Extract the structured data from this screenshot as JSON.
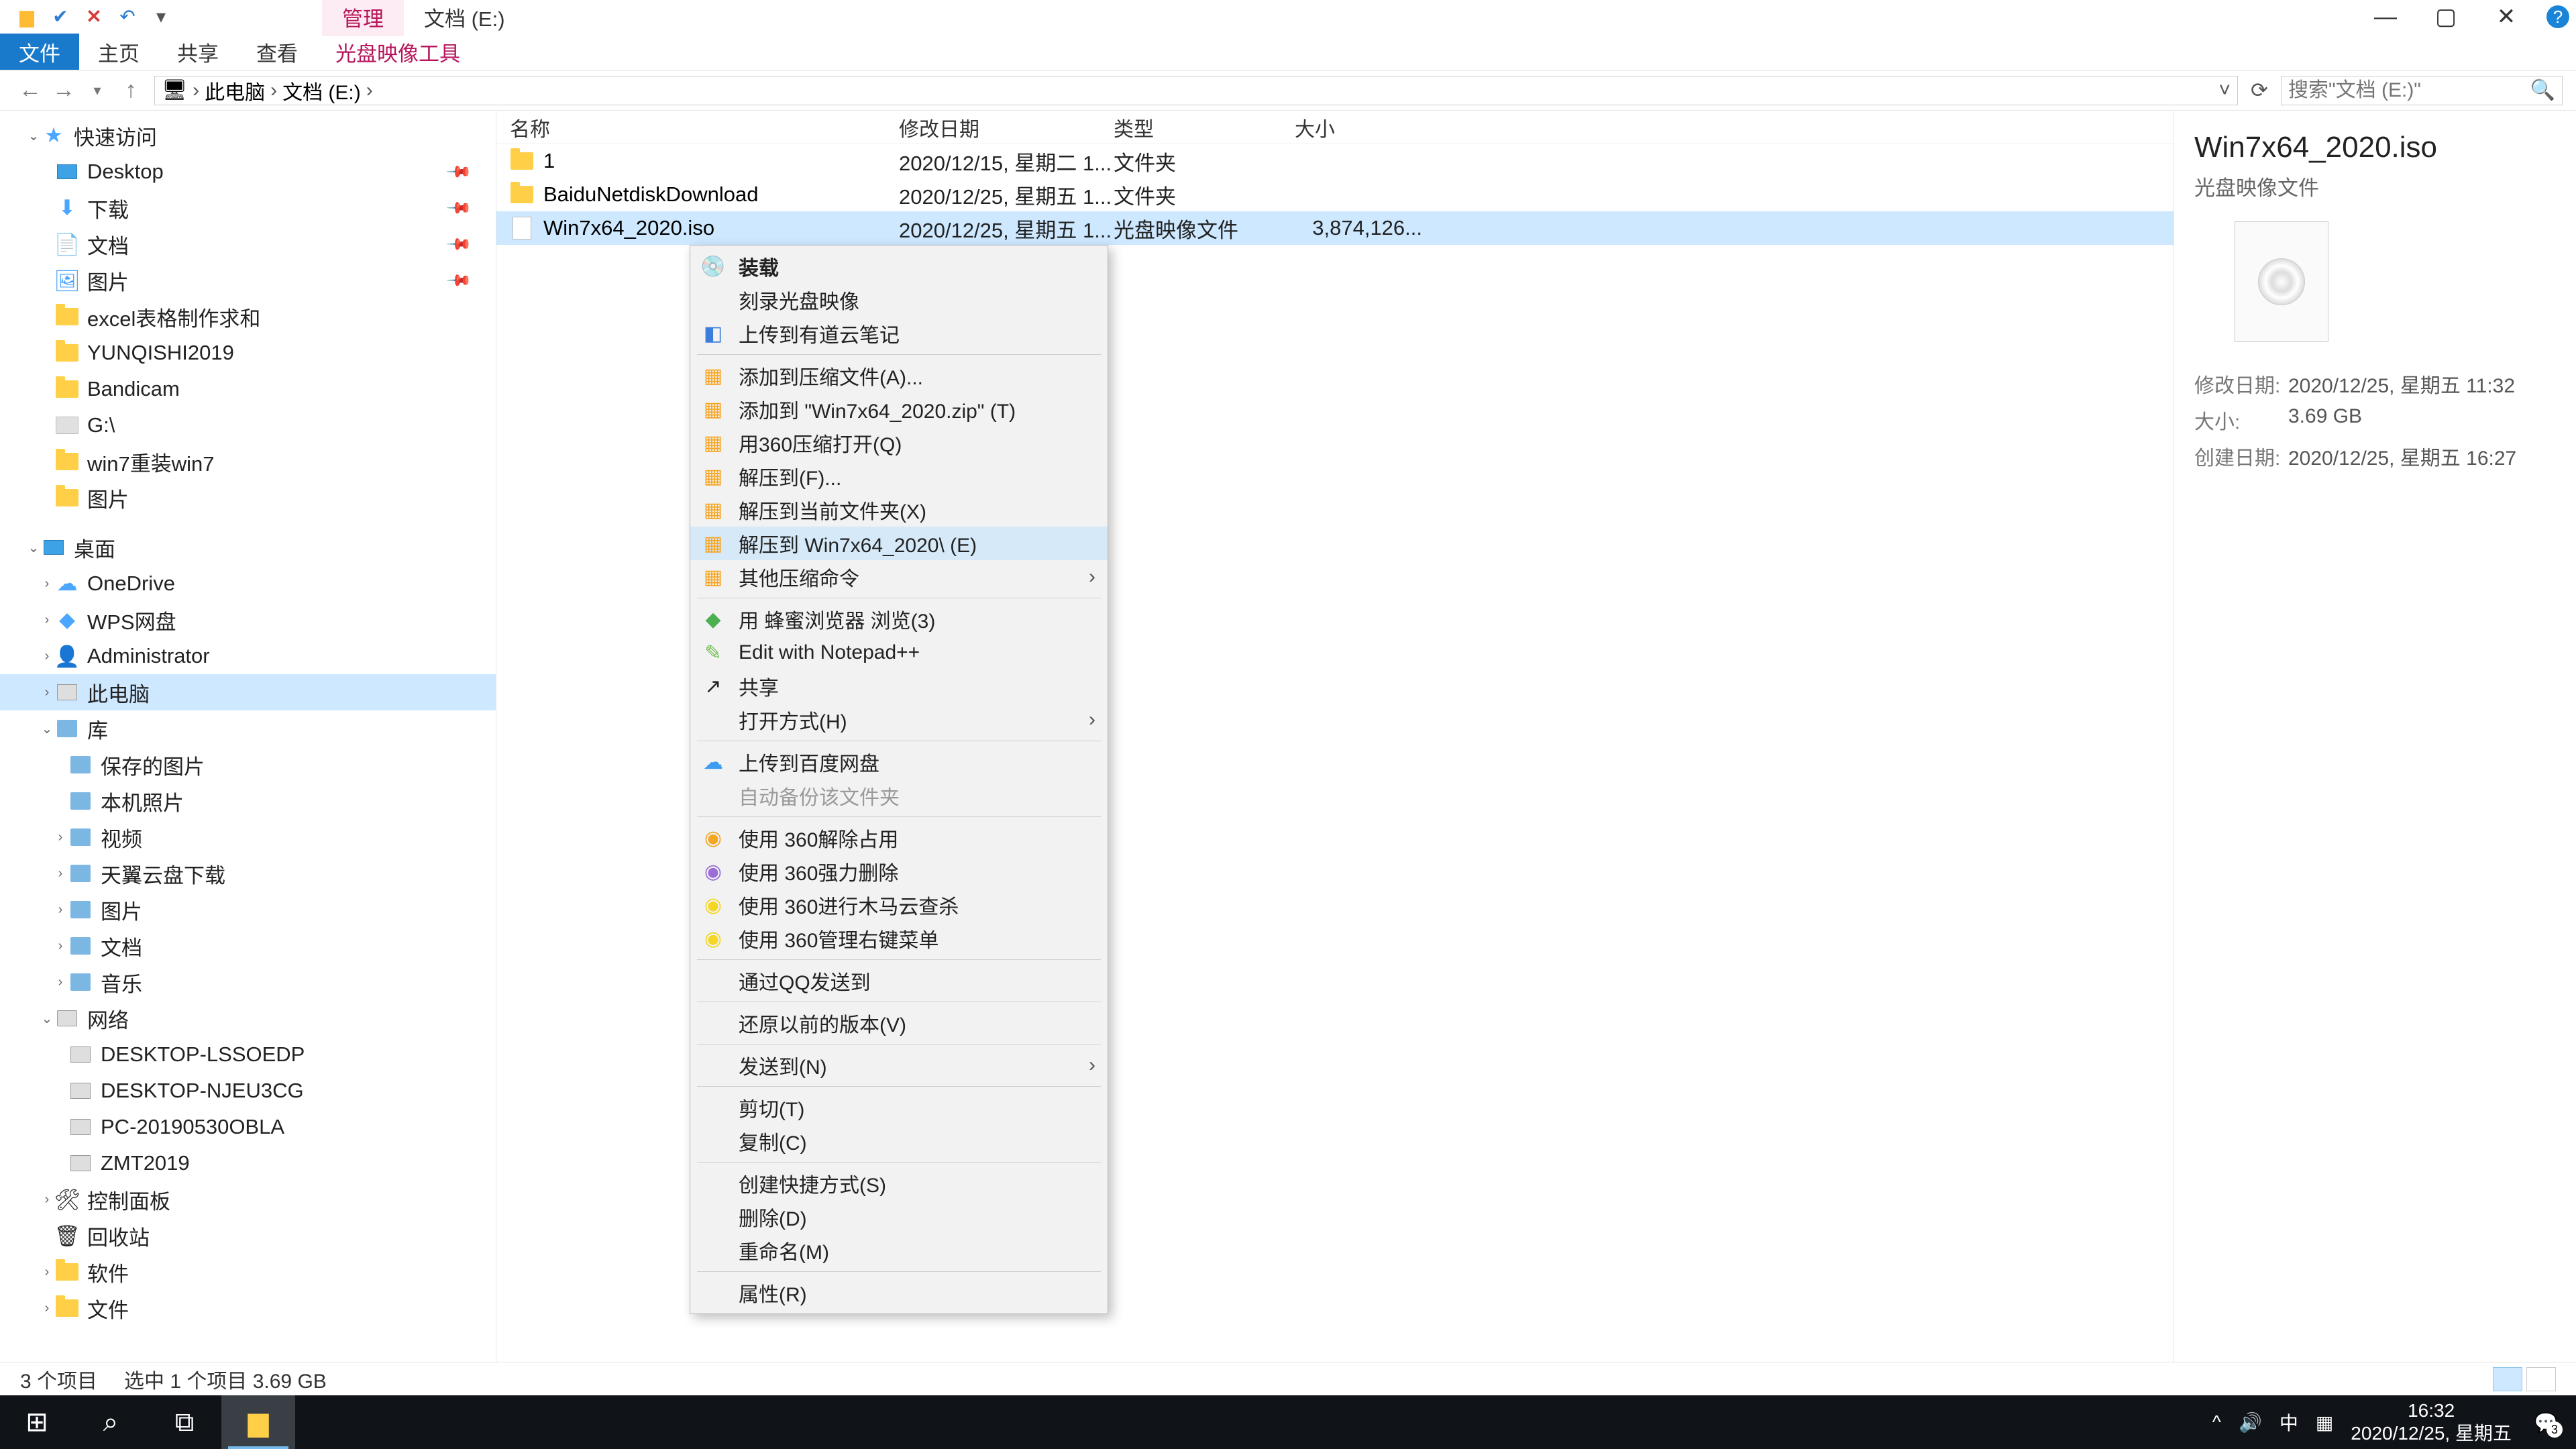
{
  "titlebar": {
    "tab_admin": "管理",
    "tab_title": "文档 (E:)"
  },
  "ribbon": {
    "file": "文件",
    "home": "主页",
    "share": "共享",
    "view": "查看",
    "iso_tool": "光盘映像工具"
  },
  "breadcrumb": {
    "pc": "此电脑",
    "drive": "文档 (E:)"
  },
  "search": {
    "placeholder": "搜索\"文档 (E:)\""
  },
  "sidebar": {
    "quick_access": "快速访问",
    "desktop": "Desktop",
    "downloads": "下载",
    "documents": "文档",
    "pictures": "图片",
    "excel": "excel表格制作求和",
    "yunqishi": "YUNQISHI2019",
    "bandicam": "Bandicam",
    "gdrive": "G:\\",
    "win7setup": "win7重装win7",
    "pictures2": "图片",
    "desktop_group": "桌面",
    "onedrive": "OneDrive",
    "wps": "WPS网盘",
    "admin": "Administrator",
    "this_pc": "此电脑",
    "library": "库",
    "saved_pic": "保存的图片",
    "local_pic": "本机照片",
    "video": "视频",
    "tianyi": "天翼云盘下载",
    "pictures3": "图片",
    "documents2": "文档",
    "music": "音乐",
    "network": "网络",
    "net1": "DESKTOP-LSSOEDP",
    "net2": "DESKTOP-NJEU3CG",
    "net3": "PC-20190530OBLA",
    "net4": "ZMT2019",
    "ctrl_panel": "控制面板",
    "recycle": "回收站",
    "software": "软件",
    "files": "文件"
  },
  "columns": {
    "name": "名称",
    "date": "修改日期",
    "type": "类型",
    "size": "大小"
  },
  "rows": [
    {
      "name": "1",
      "date": "2020/12/15, 星期二 1...",
      "type": "文件夹",
      "size": ""
    },
    {
      "name": "BaiduNetdiskDownload",
      "date": "2020/12/25, 星期五 1...",
      "type": "文件夹",
      "size": ""
    },
    {
      "name": "Win7x64_2020.iso",
      "date": "2020/12/25, 星期五 1...",
      "type": "光盘映像文件",
      "size": "3,874,126..."
    }
  ],
  "ctx": {
    "mount": "装载",
    "burn": "刻录光盘映像",
    "youdao": "上传到有道云笔记",
    "addzip": "添加到压缩文件(A)...",
    "addzip2": "添加到 \"Win7x64_2020.zip\" (T)",
    "open360zip": "用360压缩打开(Q)",
    "extract_to": "解压到(F)...",
    "extract_here": "解压到当前文件夹(X)",
    "extract_named": "解压到 Win7x64_2020\\ (E)",
    "other_zip": "其他压缩命令",
    "browser": "用 蜂蜜浏览器 浏览(3)",
    "npp": "Edit with Notepad++",
    "share": "共享",
    "open_with": "打开方式(H)",
    "upload_baidu": "上传到百度网盘",
    "auto_backup": "自动备份该文件夹",
    "unlock360": "使用 360解除占用",
    "forcedel360": "使用 360强力删除",
    "trojan360": "使用 360进行木马云查杀",
    "menu360": "使用 360管理右键菜单",
    "qq_send": "通过QQ发送到",
    "restore": "还原以前的版本(V)",
    "send_to": "发送到(N)",
    "cut": "剪切(T)",
    "copy": "复制(C)",
    "shortcut": "创建快捷方式(S)",
    "delete": "删除(D)",
    "rename": "重命名(M)",
    "props": "属性(R)"
  },
  "details": {
    "title": "Win7x64_2020.iso",
    "subtitle": "光盘映像文件",
    "mod_lbl": "修改日期:",
    "mod_val": "2020/12/25, 星期五 11:32",
    "size_lbl": "大小:",
    "size_val": "3.69 GB",
    "create_lbl": "创建日期:",
    "create_val": "2020/12/25, 星期五 16:27"
  },
  "status": {
    "count": "3 个项目",
    "selected": "选中 1 个项目  3.69 GB"
  },
  "tray": {
    "ime": "中",
    "time": "16:32",
    "date": "2020/12/25, 星期五",
    "notif_count": "3"
  }
}
